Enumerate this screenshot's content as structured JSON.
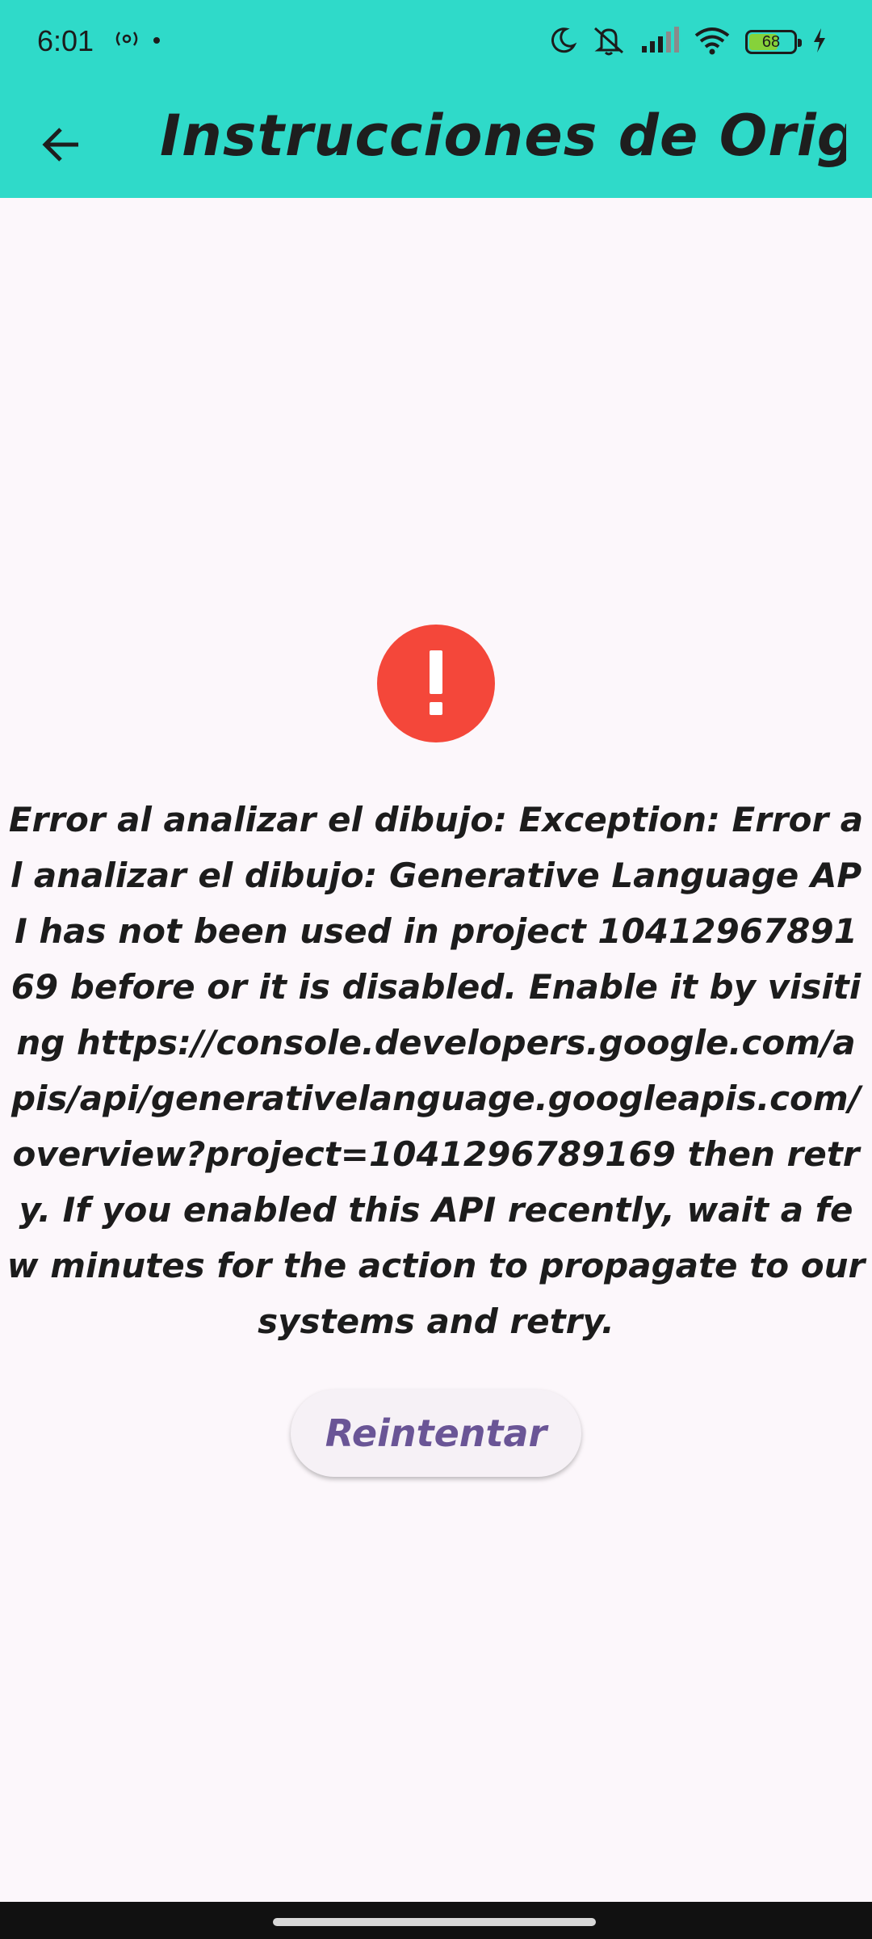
{
  "status_bar": {
    "time": "6:01",
    "battery": "68",
    "battery_level": 0.68,
    "icons": [
      "radio-icon",
      "dot-icon",
      "moon-icon",
      "mute-icon",
      "signal-icon",
      "wifi-icon",
      "battery-icon",
      "charging-icon"
    ]
  },
  "app_bar": {
    "title": "Instrucciones de Orig...",
    "back_icon": "arrow-left-icon",
    "color": "#2fdac9"
  },
  "error": {
    "icon": "exclamation-icon",
    "icon_color": "#f4473a",
    "message": "Error al analizar el dibujo: Exception: Error al analizar el dibujo: Generative Language API has not been used in project 1041296789169 before or it is disabled. Enable it by visiting https://console.developers.google.com/apis/api/generativelanguage.googleapis.com/overview?project=1041296789169 then retry. If you enabled this API recently, wait a few minutes for the action to propagate to our systems and retry."
  },
  "retry_button": {
    "label": "Reintentar",
    "color": "#6a5596"
  }
}
